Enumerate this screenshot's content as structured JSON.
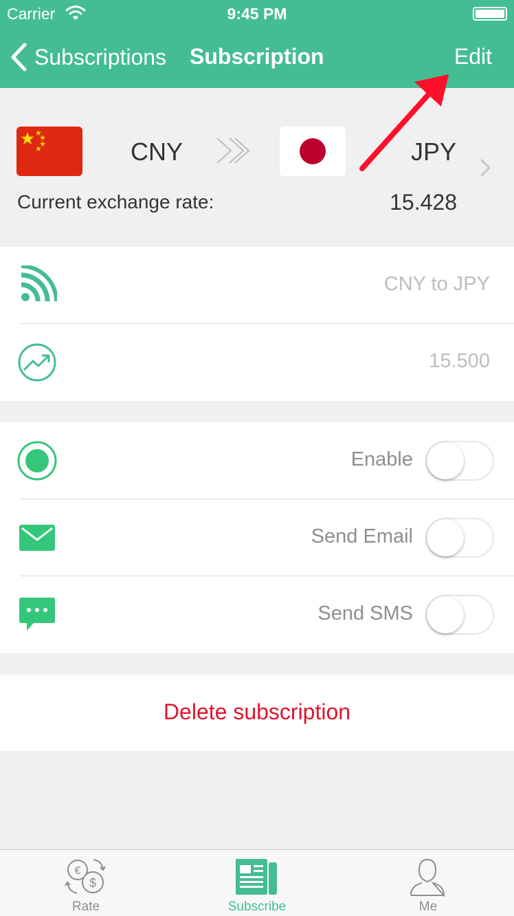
{
  "status_bar": {
    "carrier": "Carrier",
    "time": "9:45 PM"
  },
  "nav": {
    "back_label": "Subscriptions",
    "title": "Subscription",
    "edit_label": "Edit"
  },
  "exchange": {
    "from_currency": "CNY",
    "to_currency": "JPY",
    "rate_label": "Current exchange rate:",
    "rate_value": "15.428"
  },
  "subscription": {
    "pair_value": "CNY to JPY",
    "target_value": "15.500"
  },
  "settings": {
    "enable": {
      "label": "Enable",
      "on": false
    },
    "send_email": {
      "label": "Send Email",
      "on": false
    },
    "send_sms": {
      "label": "Send SMS",
      "on": false
    }
  },
  "delete_label": "Delete subscription",
  "tabs": [
    {
      "label": "Rate",
      "active": false
    },
    {
      "label": "Subscribe",
      "active": true
    },
    {
      "label": "Me",
      "active": false
    }
  ],
  "colors": {
    "accent": "#44bd92",
    "icon_green": "#34c77b",
    "delete_red": "#e0142c",
    "annotation_red": "#ff0f2b"
  }
}
